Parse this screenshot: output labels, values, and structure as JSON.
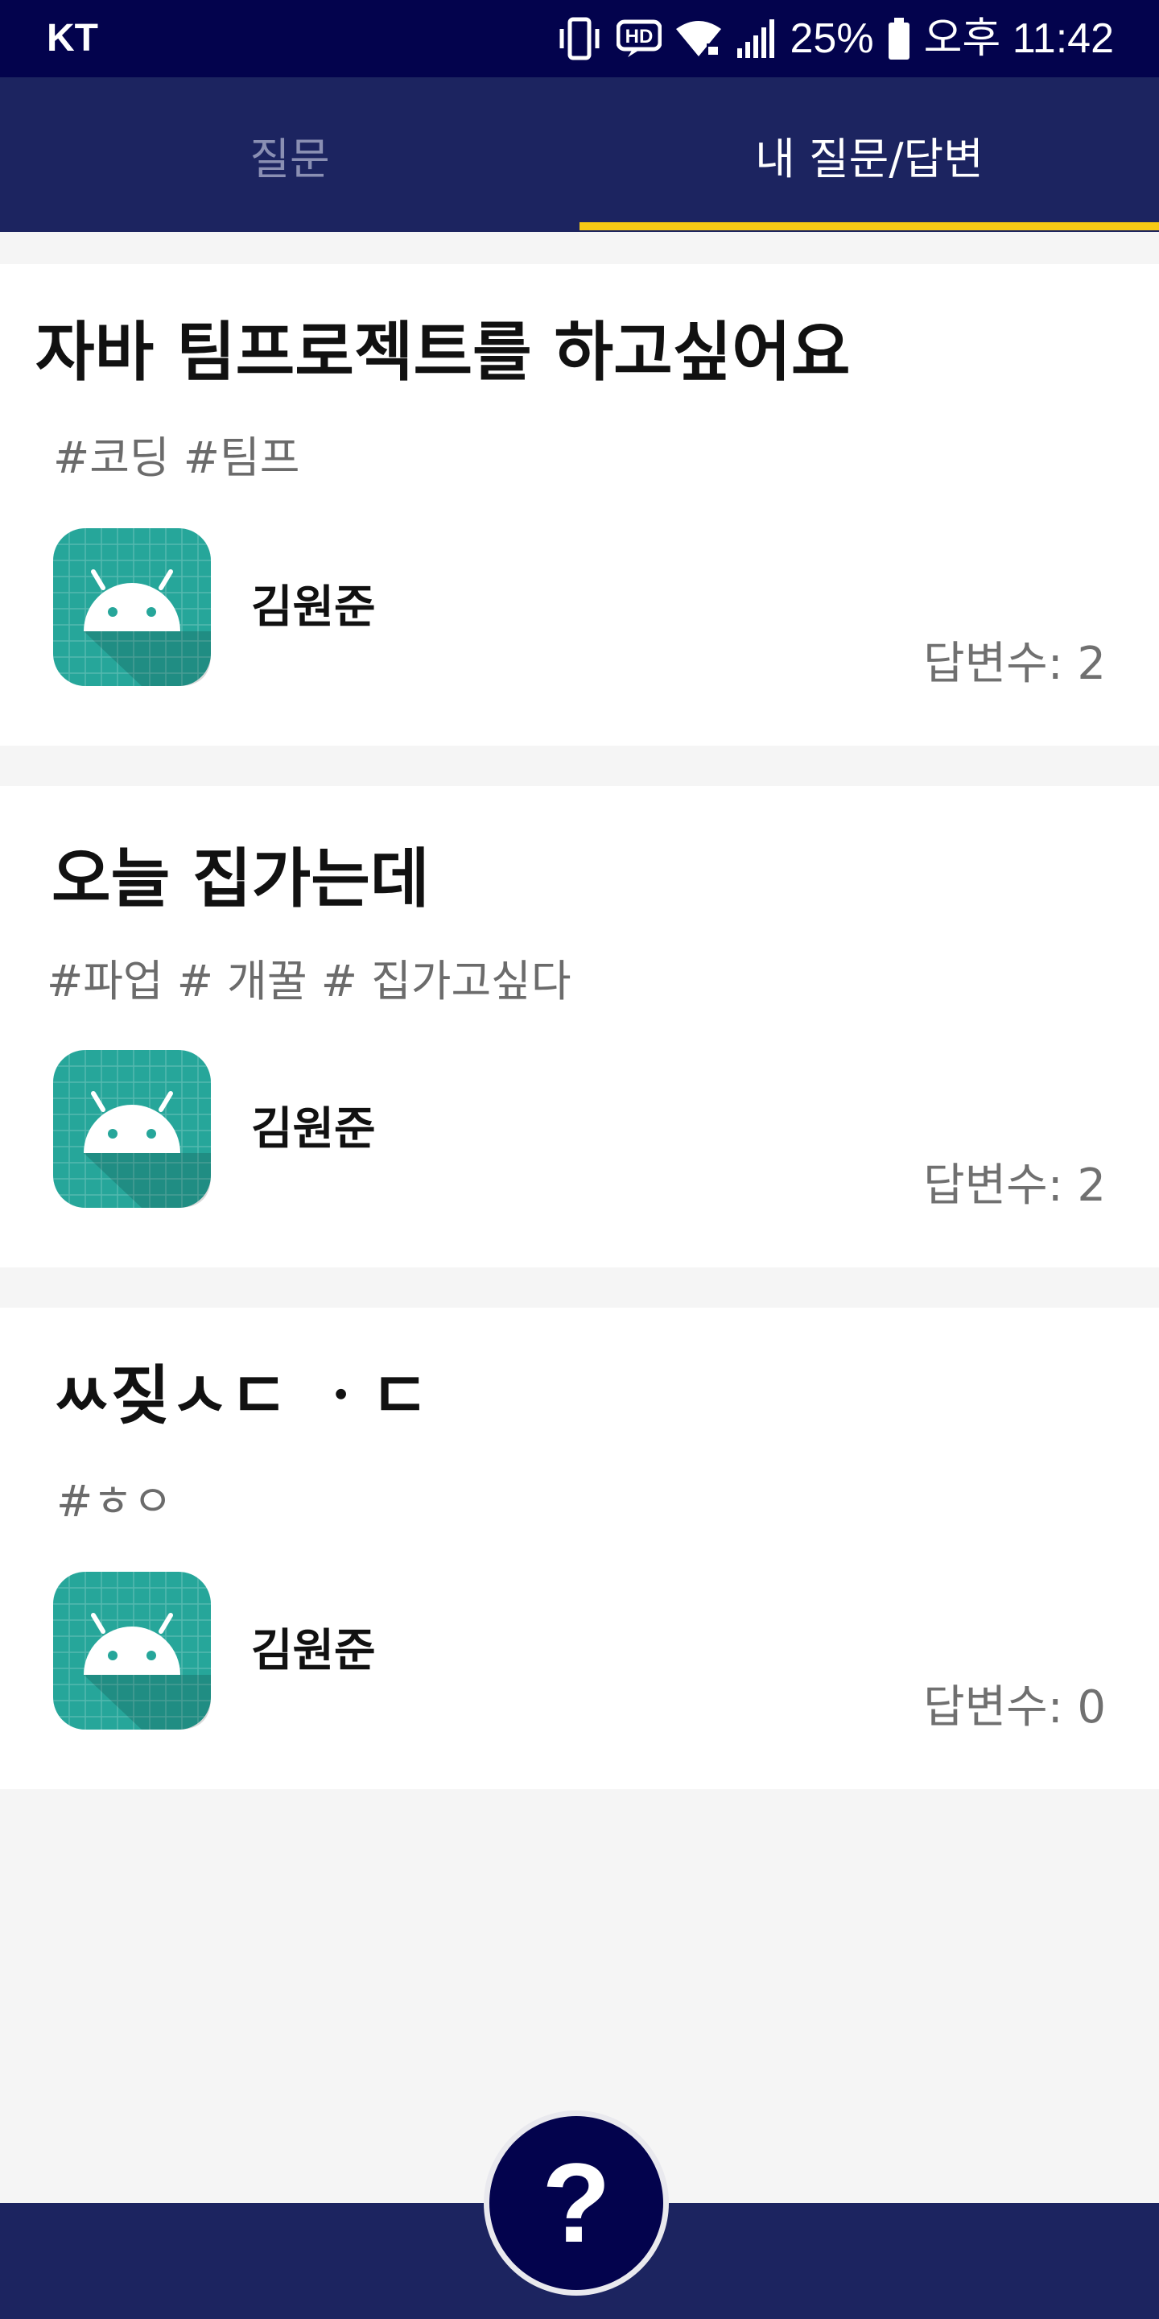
{
  "status_bar": {
    "carrier": "KT",
    "battery": "25%",
    "time": "오후 11:42",
    "icons": [
      "vibrate-icon",
      "hd-icon",
      "wifi-icon",
      "signal-icon",
      "battery-icon"
    ]
  },
  "tabs": [
    {
      "label": "질문",
      "selected": false
    },
    {
      "label": "내 질문/답변",
      "selected": true
    }
  ],
  "colors": {
    "status_bar": "#03034d",
    "app_bar": "#1c2460",
    "tab_indicator": "#f6c915",
    "avatar": "#26a69a",
    "fab": "#03034d"
  },
  "questions": [
    {
      "title": "자바 팀프로젝트를 하고싶어요",
      "tags": "#코딩 #팀프",
      "author": "김원준",
      "answers": "답변수: 2"
    },
    {
      "title": "오늘 집가는데",
      "tags": "#파업 # 개꿀 # 집가고싶다",
      "author": "김원준",
      "answers": "답변수: 2"
    },
    {
      "title": "ㅆ짖ㅅㄷ ㆍㄷ",
      "tags": "#ㅎㅇ",
      "author": "김원준",
      "answers": "답변수: 0"
    }
  ],
  "fab": {
    "label": "?",
    "icon": "question-icon"
  }
}
